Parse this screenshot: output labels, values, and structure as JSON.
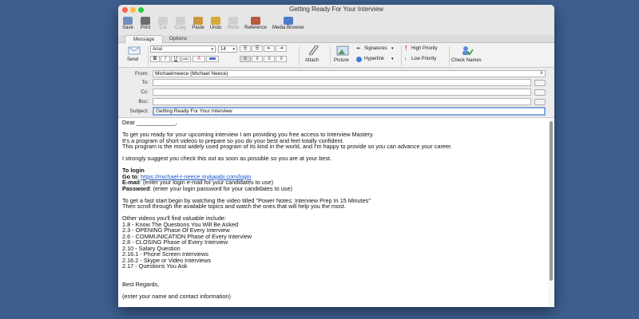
{
  "window": {
    "title": "Getting Ready For Your Interview"
  },
  "toolbar": [
    {
      "label": "Save",
      "name": "save-button",
      "icon": "save-icon",
      "enabled": true
    },
    {
      "label": "Print",
      "name": "print-button",
      "icon": "print-icon",
      "enabled": true
    },
    {
      "label": "Cut",
      "name": "cut-button",
      "icon": "scissors-icon",
      "enabled": false
    },
    {
      "label": "Copy",
      "name": "copy-button",
      "icon": "copy-icon",
      "enabled": false
    },
    {
      "label": "Paste",
      "name": "paste-button",
      "icon": "clipboard-icon",
      "enabled": true
    },
    {
      "label": "Undo",
      "name": "undo-button",
      "icon": "undo-icon",
      "enabled": true
    },
    {
      "label": "Redo",
      "name": "redo-button",
      "icon": "redo-icon",
      "enabled": false
    },
    {
      "label": "Reference",
      "name": "reference-button",
      "icon": "book-icon",
      "enabled": true
    },
    {
      "label": "Media Browser",
      "name": "media-browser-button",
      "icon": "media-icon",
      "enabled": true
    }
  ],
  "tabs": [
    {
      "label": "Message",
      "active": true
    },
    {
      "label": "Options",
      "active": false
    }
  ],
  "ribbon": {
    "send_label": "Send",
    "font_name": "Arial",
    "font_size": "14",
    "attach_label": "Attach",
    "picture_label": "Picture",
    "signatures_label": "Signatures",
    "hyperlink_label": "Hyperlink",
    "high_priority_label": "High Priority",
    "low_priority_label": "Low Priority",
    "check_names_label": "Check Names"
  },
  "header": {
    "from_label": "From:",
    "from_value": "Michaelrneece (Michael Neece)",
    "to_label": "To:",
    "to_value": "",
    "cc_label": "Cc:",
    "cc_value": "",
    "bcc_label": "Bcc:",
    "bcc_value": "",
    "subject_label": "Subject:",
    "subject_value": "Getting Ready For Your Interview"
  },
  "message": {
    "greeting": "Dear ____________,",
    "intro": [
      "To get you ready for your upcoming interview I am providing you free access to Interview Mastery.",
      "It's a program of short videos to prepare so you do your best and feel totally confident.",
      "This program is the most widely used program of its kind in the world, and I'm happy to provide so you can advance your career."
    ],
    "suggest": "I strongly suggest you check this out as soon as possible so you are at your best.",
    "login_heading": "To login",
    "goto_label": "Go to",
    "goto_url": "https://michael-r-neece.mykajabi.com/login",
    "email_label": "E-mail",
    "email_text": ": (enter your login e-mail for your candidates to use)",
    "password_label": "Password",
    "password_text": ": (enter your login password for your candidates to use)",
    "fast_start": [
      "To get a fast start begin by watching the video titled \"Power Notes: Interview Prep In 15 Minutes\"",
      "Then scroll through the available topics and watch the ones that will help you the most."
    ],
    "other_videos_heading": "Other videos you'll find valuable include:",
    "videos": [
      "1.8 - Know The Questions You Will Be Asked",
      "2.3 - OPENING Phase Of Every Interview",
      "2.6 - COMMUNICATION Phase of Every Interview",
      "2.8 - CLOSING Phase of Every Interview",
      "2.10 - Salary Question",
      "2.16.1 - Phone Screen Interviews",
      "2.16.2 - Skype or Video Interviews",
      "2.17 - Questions You Ask"
    ],
    "closing": "Best Regards,",
    "signature": "(enter your name and contact information)"
  },
  "colors": {
    "desktop": "#3d5f8f",
    "link": "#1a55c8"
  }
}
